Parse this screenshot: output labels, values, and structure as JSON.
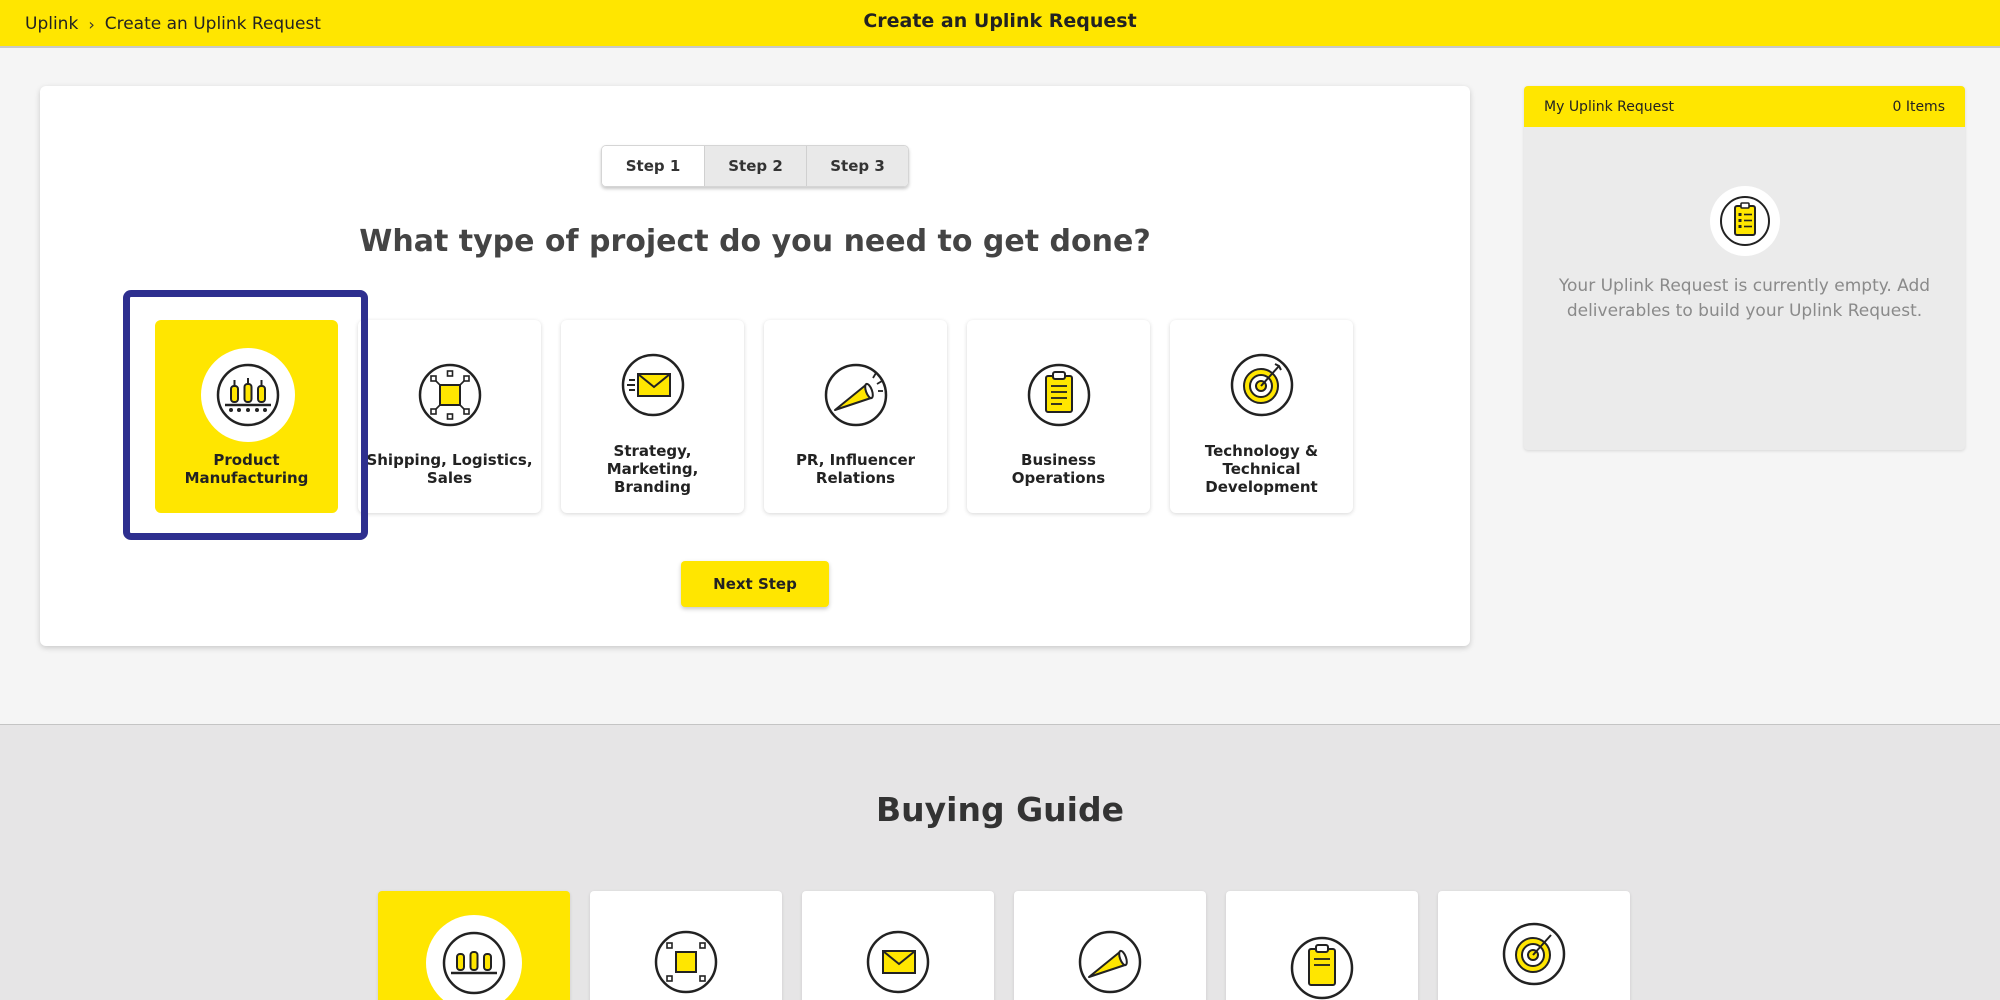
{
  "header": {
    "breadcrumb_root": "Uplink",
    "breadcrumb_sep": "›",
    "breadcrumb_current": "Create an Uplink Request",
    "title": "Create an Uplink Request"
  },
  "steps": [
    {
      "label": "Step 1",
      "active": true
    },
    {
      "label": "Step 2",
      "active": false
    },
    {
      "label": "Step 3",
      "active": false
    }
  ],
  "question": "What type of project do you need to get done?",
  "categories": [
    {
      "line1": "Product",
      "line2": "Manufacturing",
      "line3": "",
      "icon": "manufacturing-icon",
      "selected": true
    },
    {
      "line1": "Shipping, Logistics,",
      "line2": "Sales",
      "line3": "",
      "icon": "logistics-network-icon",
      "selected": false
    },
    {
      "line1": "Strategy,",
      "line2": "Marketing,",
      "line3": "Branding",
      "icon": "envelope-icon",
      "selected": false
    },
    {
      "line1": "PR, Influencer",
      "line2": "Relations",
      "line3": "",
      "icon": "megaphone-icon",
      "selected": false
    },
    {
      "line1": "Business",
      "line2": "Operations",
      "line3": "",
      "icon": "clipboard-icon",
      "selected": false
    },
    {
      "line1": "Technology &",
      "line2": "Technical",
      "line3": "Development",
      "icon": "target-icon",
      "selected": false
    }
  ],
  "next_button": "Next Step",
  "side_panel": {
    "title": "My Uplink Request",
    "count": "0 Items",
    "empty_line1": "Your Uplink Request is currently empty. Add",
    "empty_line2": "deliverables to build your Uplink Request."
  },
  "buying_guide": {
    "title": "Buying Guide"
  },
  "colors": {
    "brand_yellow": "#ffe600",
    "highlight_frame": "#2e2f8f",
    "dark": "#222222"
  }
}
